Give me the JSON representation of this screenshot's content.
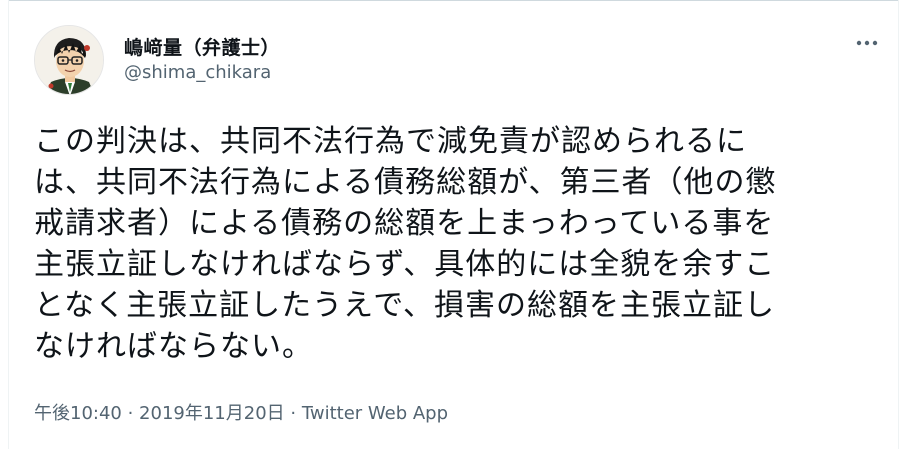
{
  "author": {
    "display_name": "嶋﨑量（弁護士）",
    "handle": "@shima_chikara",
    "avatar_icon": "user-avatar-illustration"
  },
  "menu": {
    "more_icon": "more-horizontal-icon"
  },
  "tweet": {
    "text": "この判決は、共同不法行為で減免責が認められるに\nは、共同不法行為による債務総額が、第三者（他の懲\n戒請求者）による債務の総額を上まっわっている事を\n主張立証しなければならず、具体的には全貌を余すこ\nとなく主張立証したうえで、損害の総額を主張立証し\nなければならない。"
  },
  "meta": {
    "time": "午後10:40",
    "separator": " · ",
    "date": "2019年11月20日",
    "source": "Twitter Web App"
  },
  "colors": {
    "text_primary": "#0f1419",
    "text_secondary": "#536471",
    "border": "#cfd9de"
  }
}
